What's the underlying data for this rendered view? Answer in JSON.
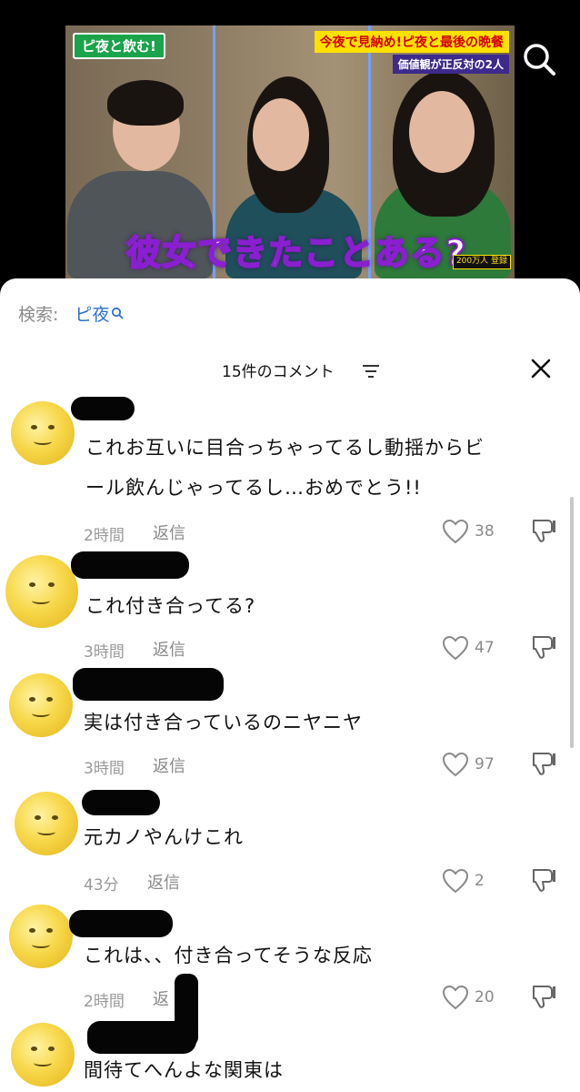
{
  "video": {
    "show_logo": "ピ夜と飲む!",
    "promo_line1": "今夜で見納め!ピ夜と最後の晩餐",
    "promo_line2": "価値観が正反対の2人",
    "caption": "彼女できたことある?",
    "corner_badge": "200万人 登録"
  },
  "search": {
    "prefix": "検索:",
    "term": "ピ夜"
  },
  "header": {
    "comment_count": "15件のコメント"
  },
  "comments": [
    {
      "text": "これお互いに目合っちゃってるし動揺からビール飲んじゃってるし…おめでとう!!",
      "time": "2時間",
      "reply": "返信",
      "likes": "38"
    },
    {
      "text": "これ付き合ってる?",
      "time": "3時間",
      "reply": "返信",
      "likes": "47"
    },
    {
      "text": "実は付き合っているのニヤニヤ",
      "time": "3時間",
      "reply": "返信",
      "likes": "97"
    },
    {
      "text": "元カノやんけこれ",
      "time": "43分",
      "reply": "返信",
      "likes": "2"
    },
    {
      "text": "これは、、付き合ってそうな反応",
      "time": "2時間",
      "reply": "返",
      "likes": "20"
    },
    {
      "text": "間待てへんよな関東は",
      "time": "",
      "reply": "",
      "likes": ""
    }
  ],
  "colors": {
    "accent_link": "#2f6fd6",
    "caption_stroke": "#8a1fd0",
    "avatar": "#f7d84a"
  }
}
